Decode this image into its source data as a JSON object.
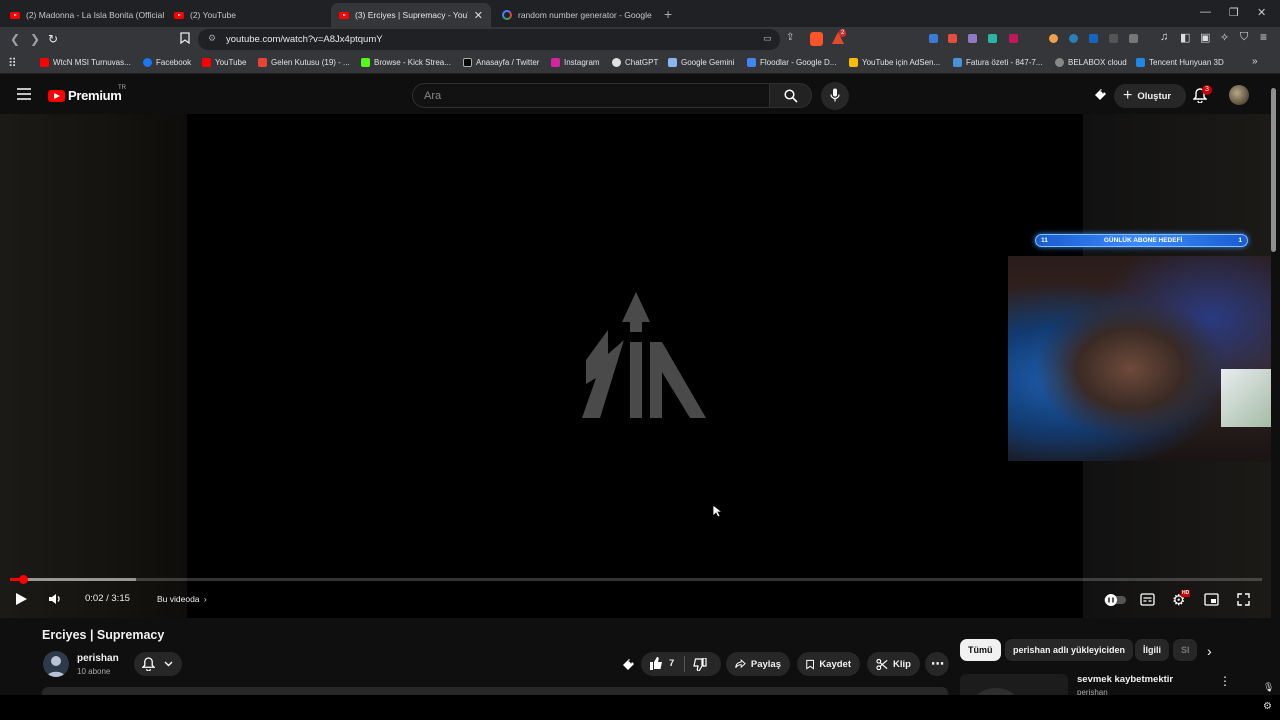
{
  "browser": {
    "tabs": [
      {
        "title": "(2) Madonna - La Isla Bonita (Official",
        "icon": "youtube-icon"
      },
      {
        "title": "(2) YouTube",
        "icon": "youtube-icon"
      },
      {
        "title": "(3) Erciyes | Supremacy - YouTub",
        "icon": "youtube-icon",
        "active": true
      },
      {
        "title": "random number generator - Google",
        "icon": "google-icon"
      }
    ],
    "url": "youtube.com/watch?v=A8Jx4ptqumY",
    "extension_badges": [
      "2"
    ],
    "bookmarks": [
      "WtcN MSI Turnuvas...",
      "Facebook",
      "YouTube",
      "Gelen Kutusu (19) - ...",
      "Browse - Kick Strea...",
      "Anasayfa / Twitter",
      "Instagram",
      "ChatGPT",
      "Google Gemini",
      "Floodlar - Google D...",
      "YouTube için AdSen...",
      "Fatura özeti - 847-7...",
      "BELABOX cloud",
      "Tencent Hunyuan 3D"
    ]
  },
  "youtube": {
    "logo_text": "Premium",
    "logo_region": "TR",
    "search_placeholder": "Ara",
    "create_label": "Oluştur",
    "notification_count": "3",
    "accent_color": "#ff0000"
  },
  "player": {
    "time_current": "0:02",
    "time_separator": " / ",
    "time_total": "3:15",
    "chapter_label": "Bu videoda",
    "progress_fraction": 0.0103,
    "settings_badge": "HD",
    "overlay": {
      "sub_goal_left": "11",
      "sub_goal_label": "GÜNLÜK ABONE HEDEFİ",
      "sub_goal_right": "1"
    }
  },
  "video": {
    "title": "Erciyes | Supremacy",
    "channel_name": "perishan",
    "subscribers": "10 abone",
    "like_count": "7",
    "share_label": "Paylaş",
    "save_label": "Kaydet",
    "clip_label": "Klip"
  },
  "related": {
    "chips": [
      "Tümü",
      "perishan adlı yükleyiciden",
      "İlgili",
      "Sl"
    ],
    "items": [
      {
        "title": "sevmek kaybetmektir",
        "channel": "perishan"
      }
    ]
  }
}
